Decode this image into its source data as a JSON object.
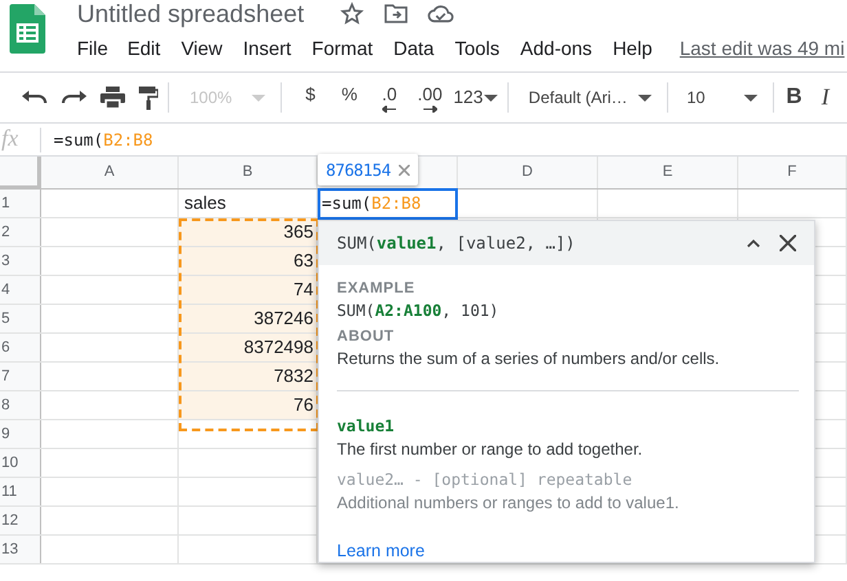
{
  "document": {
    "title": "Untitled spreadsheet",
    "last_edit": "Last edit was 49 mi"
  },
  "menu": [
    "File",
    "Edit",
    "View",
    "Insert",
    "Format",
    "Data",
    "Tools",
    "Add-ons",
    "Help"
  ],
  "toolbar": {
    "zoom": {
      "label": "100%",
      "disabled": true
    },
    "format_buttons": [
      "$",
      "%",
      ".0",
      ".00"
    ],
    "number_format": "123",
    "font": "Default (Ari…",
    "font_size": "10",
    "bold": "B",
    "italic": "I"
  },
  "formula_bar": {
    "icon_text": "fx",
    "parts": [
      {
        "text": "=sum(",
        "kind": "plain"
      },
      {
        "text": "B2:B8",
        "kind": "range"
      }
    ]
  },
  "sheet": {
    "columns": [
      {
        "kind": "header",
        "label": "A"
      },
      {
        "kind": "header",
        "label": "B"
      },
      {
        "kind": "covered"
      },
      {
        "kind": "header",
        "label": "D"
      },
      {
        "kind": "header",
        "label": "E"
      },
      {
        "kind": "header",
        "label": "F"
      }
    ],
    "rows": [
      {
        "label": "1",
        "b": "sales",
        "highlighted": false
      },
      {
        "label": "2",
        "b": "365",
        "highlighted": true
      },
      {
        "label": "3",
        "b": "63",
        "highlighted": true
      },
      {
        "label": "4",
        "b": "74",
        "highlighted": true
      },
      {
        "label": "5",
        "b": "387246",
        "highlighted": true
      },
      {
        "label": "6",
        "b": "8372498",
        "highlighted": true
      },
      {
        "label": "7",
        "b": "7832",
        "highlighted": true
      },
      {
        "label": "8",
        "b": "76",
        "highlighted": true
      },
      {
        "label": "9",
        "highlighted": false
      },
      {
        "label": "10",
        "highlighted": false
      },
      {
        "label": "11",
        "highlighted": false
      },
      {
        "label": "12",
        "highlighted": false
      },
      {
        "label": "13",
        "highlighted": false
      }
    ],
    "active_cell": {
      "parts": [
        {
          "text": "=sum(",
          "kind": "plain"
        },
        {
          "text": "B2:B8",
          "kind": "range"
        }
      ]
    },
    "result_tooltip": "8768154"
  },
  "help_popup": {
    "signature": [
      {
        "text": "SUM(",
        "kind": "plain"
      },
      {
        "text": "value1",
        "kind": "param"
      },
      {
        "text": ", [value2, …])",
        "kind": "plain"
      }
    ],
    "example_heading": "EXAMPLE",
    "example": [
      {
        "text": "SUM(",
        "kind": "plain"
      },
      {
        "text": "A2:A100",
        "kind": "param"
      },
      {
        "text": ", 101)",
        "kind": "plain"
      }
    ],
    "about_heading": "ABOUT",
    "about": "Returns the sum of a series of numbers and/or cells.",
    "params": [
      {
        "name": "value1",
        "optional": false,
        "description": "The first number or range to add together."
      },
      {
        "name": "value2… - [optional] repeatable",
        "optional": true,
        "description": "Additional numbers or ranges to add to value1."
      }
    ],
    "link": "Learn more"
  }
}
